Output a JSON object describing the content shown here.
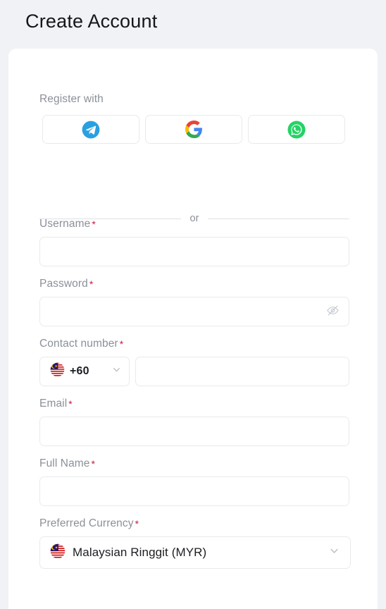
{
  "page": {
    "title": "Create Account",
    "background_color": "#f1f2f6",
    "card_color": "#ffffff"
  },
  "social": {
    "label": "Register with",
    "buttons": [
      {
        "name": "telegram",
        "icon": "telegram-icon",
        "color": "#29a9e9"
      },
      {
        "name": "google",
        "icon": "google-icon",
        "color": "#4285f4"
      },
      {
        "name": "whatsapp",
        "icon": "whatsapp-icon",
        "color": "#25d366"
      }
    ]
  },
  "divider": {
    "text": "or"
  },
  "form": {
    "required_marker": "*",
    "required_color": "#c41d45",
    "fields": {
      "username": {
        "label": "Username",
        "value": "",
        "placeholder": ""
      },
      "password": {
        "label": "Password",
        "value": "",
        "placeholder": "",
        "visibility_icon": "eye-off-icon"
      },
      "contact": {
        "label": "Contact number",
        "country_flag": "malaysia-flag-icon",
        "country_code": "+60",
        "value": "",
        "placeholder": ""
      },
      "email": {
        "label": "Email",
        "value": "",
        "placeholder": ""
      },
      "full_name": {
        "label": "Full Name",
        "value": "",
        "placeholder": ""
      },
      "currency": {
        "label": "Preferred Currency",
        "flag": "malaysia-flag-icon",
        "selected": "Malaysian Ringgit (MYR)"
      }
    }
  }
}
